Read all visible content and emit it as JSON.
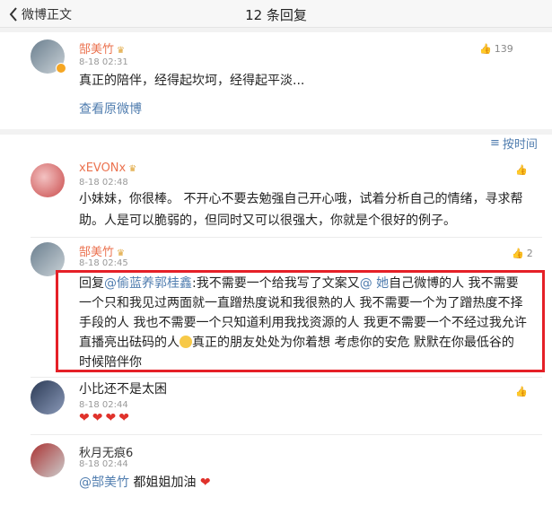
{
  "header": {
    "back_label": "微博正文",
    "title": "12 条回复"
  },
  "post": {
    "author": "郜美竹",
    "date": "8-18 02:31",
    "likes": "139",
    "content": "真正的陪伴，经得起坎坷，经得起平淡...",
    "view_original": "查看原微博"
  },
  "sort_label": "按时间",
  "replies": [
    {
      "author": "xEVONx",
      "date": "8-18 02:48",
      "likes": "",
      "line1": "小妹妹，你很棒。 不开心不要去勉强自己开心哦，试着分析自己的情绪，寻求帮",
      "line2": "助。人是可以脆弱的，但同时又可以很强大，你就是个很好的例子。"
    },
    {
      "author": "郜美竹",
      "date": "8-18 02:45",
      "likes": "2",
      "reply_prefix": "回复",
      "mention1": "@偷蓝养郭桂鑫",
      "line1_rest": ":我不需要一个给我写了文案又",
      "mention2": "@ 她",
      "line1_tail": "自己微博的人 我不需要",
      "line2": "一个只和我见过两面就一直蹭热度说和我很熟的人 我不需要一个为了蹭热度不择",
      "line3": "手段的人 我也不需要一个只知道利用我找资源的人 我更不需要一个不经过我允许",
      "line4a": "直播亮出砝码的人",
      "line4b": "真正的朋友处处为你着想 考虑你的安危 默默在你最低谷的",
      "line5": "时候陪伴你"
    },
    {
      "author": "",
      "date": "8-18 02:44",
      "likes": "",
      "content": "小比还不是太困",
      "emoji_row": "❤❤❤❤"
    },
    {
      "author": "秋月无痕6",
      "date": "8-18 02:44",
      "mention": "@郜美竹",
      "content": "都姐姐加油",
      "heart": "❤"
    }
  ],
  "colors": {
    "highlight": "#e52027",
    "link": "#507daf",
    "name": "#eb7350"
  }
}
